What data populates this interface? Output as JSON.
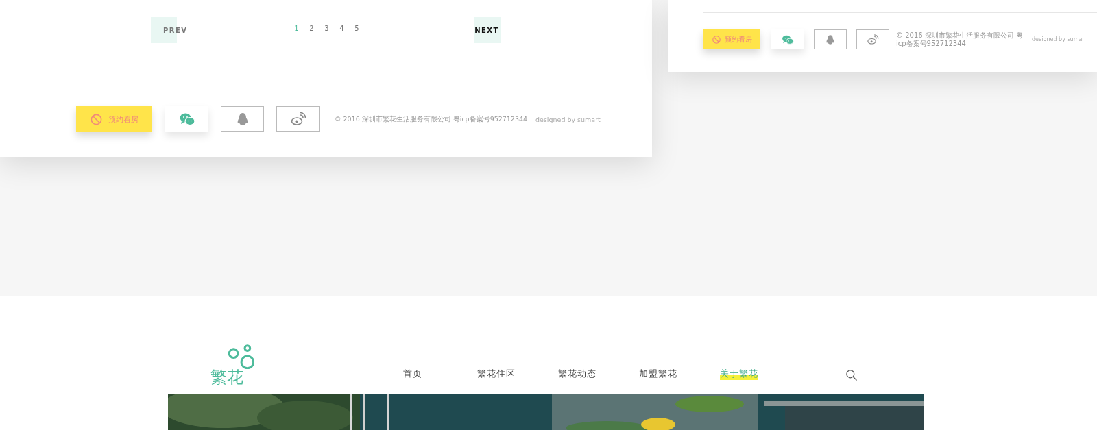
{
  "left_panel": {
    "pagination": {
      "prev": "PREV",
      "next": "NEXT",
      "pages": [
        {
          "label": "1",
          "selected": true
        },
        {
          "label": "2",
          "selected": false
        },
        {
          "label": "3",
          "selected": false
        },
        {
          "label": "4",
          "selected": false
        },
        {
          "label": "5",
          "selected": false
        }
      ]
    },
    "footer": {
      "book_button": "预约看房",
      "copyright": "© 2016 深圳市繁花生活服务有限公司  粤icp备案号952712344",
      "credit": "designed by sumart"
    }
  },
  "right_panel": {
    "footer": {
      "book_button": "预约看房",
      "copyright": "© 2016 深圳市繁花生活服务有限公司  粤icp备案号952712344",
      "credit": "designed by sumar"
    }
  },
  "site_header": {
    "logo_text": "繁花",
    "nav": [
      {
        "label": "首页",
        "selected": false
      },
      {
        "label": "繁花住区",
        "selected": false
      },
      {
        "label": "繁花动态",
        "selected": false
      },
      {
        "label": "加盟繁花",
        "selected": false
      },
      {
        "label": "关于繁花",
        "selected": true
      }
    ]
  }
}
